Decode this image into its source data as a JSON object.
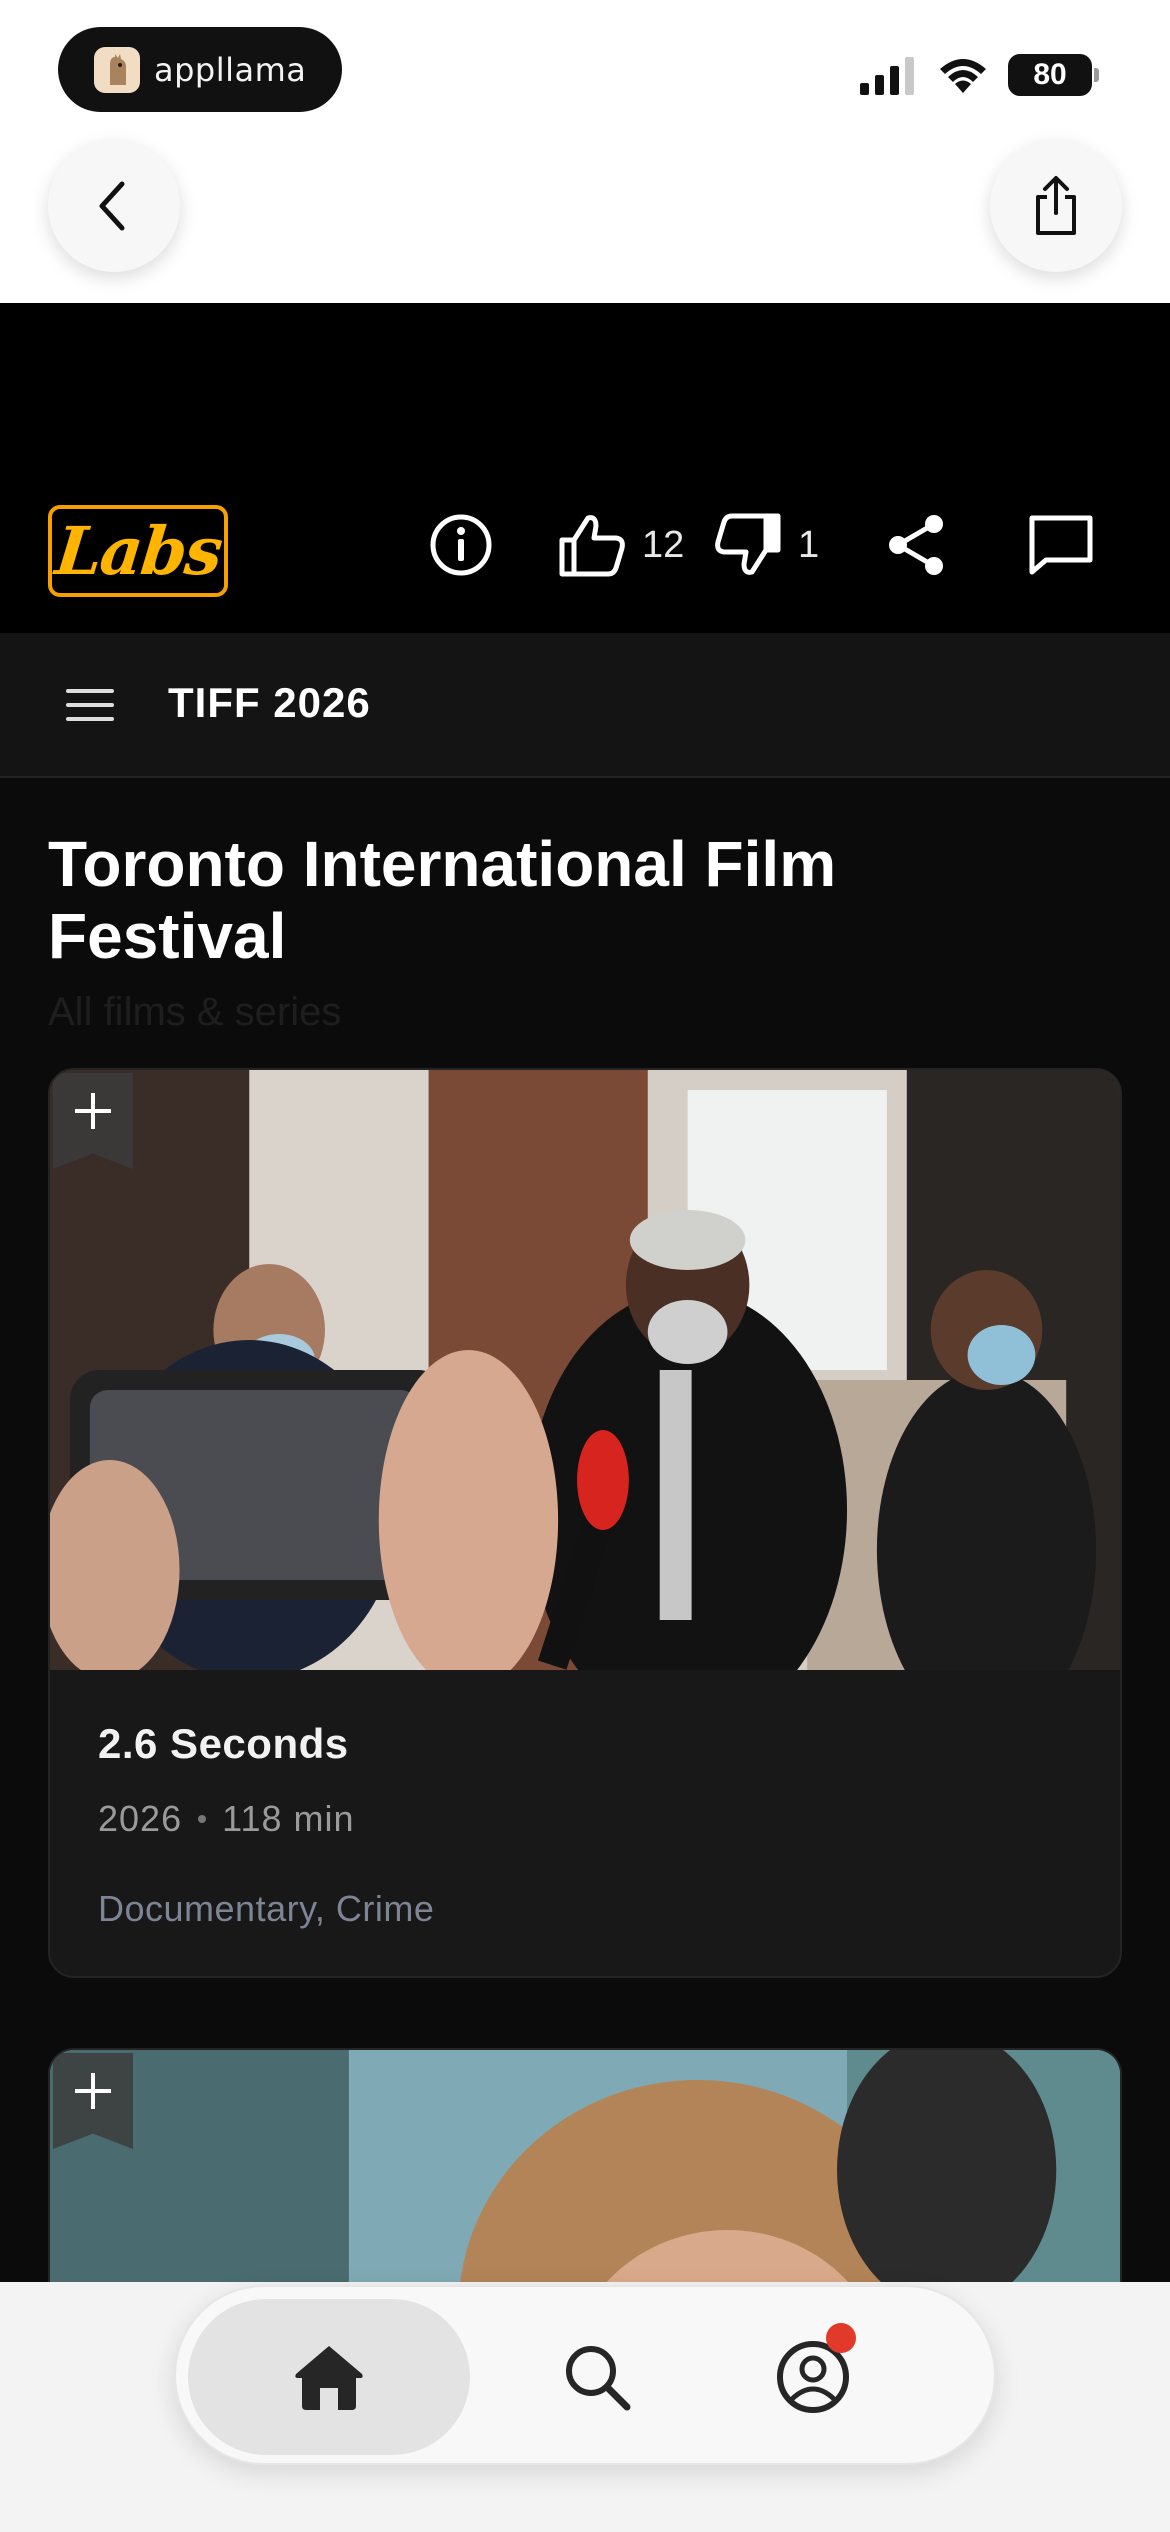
{
  "status_bar": {
    "app_name": "appllama",
    "battery": "80"
  },
  "site": {
    "logo_text": "Labs",
    "likes": "12",
    "dislikes": "1"
  },
  "nav": {
    "title": "TIFF 2026"
  },
  "page": {
    "title": "Toronto International Film Festival",
    "subtitle": "All films & series"
  },
  "films": [
    {
      "title": "2.6 Seconds",
      "year": "2026",
      "duration": "118 min",
      "genres": "Documentary, Crime"
    }
  ],
  "tabs": [
    "home",
    "search",
    "profile"
  ],
  "colors": {
    "accent": "#ffb400",
    "notification": "#e23a2a",
    "background": "#0b0b0b",
    "card": "#181818"
  }
}
